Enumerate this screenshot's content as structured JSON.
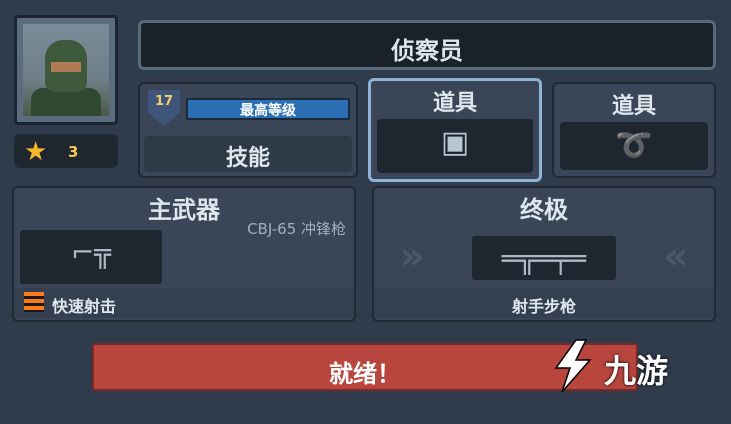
{
  "profile": {
    "star_count": "3",
    "icons": {
      "star": "star-icon",
      "avatar": "soldier-avatar"
    }
  },
  "header": {
    "title": "侦察员"
  },
  "level": {
    "number": "17",
    "bar_label": "最高等级",
    "skill_label": "技能"
  },
  "items": [
    {
      "title": "道具",
      "icon": "gadget-icon"
    },
    {
      "title": "道具",
      "icon": "rope-hook-icon"
    }
  ],
  "primary_weapon": {
    "title": "主武器",
    "name": "CBJ-65 冲锋枪",
    "trait": "快速射击",
    "icon": "smg-icon"
  },
  "ultimate": {
    "title": "终极",
    "weapon": "射手步枪",
    "icon": "rifle-icon"
  },
  "ready_button": {
    "label": "就绪！"
  },
  "watermark": {
    "text": "九游"
  },
  "colors": {
    "ready": "#b9453f",
    "selected_border": "#8fb3d6",
    "level_bar": "#2d6fb5",
    "star": "#f5b52a"
  }
}
